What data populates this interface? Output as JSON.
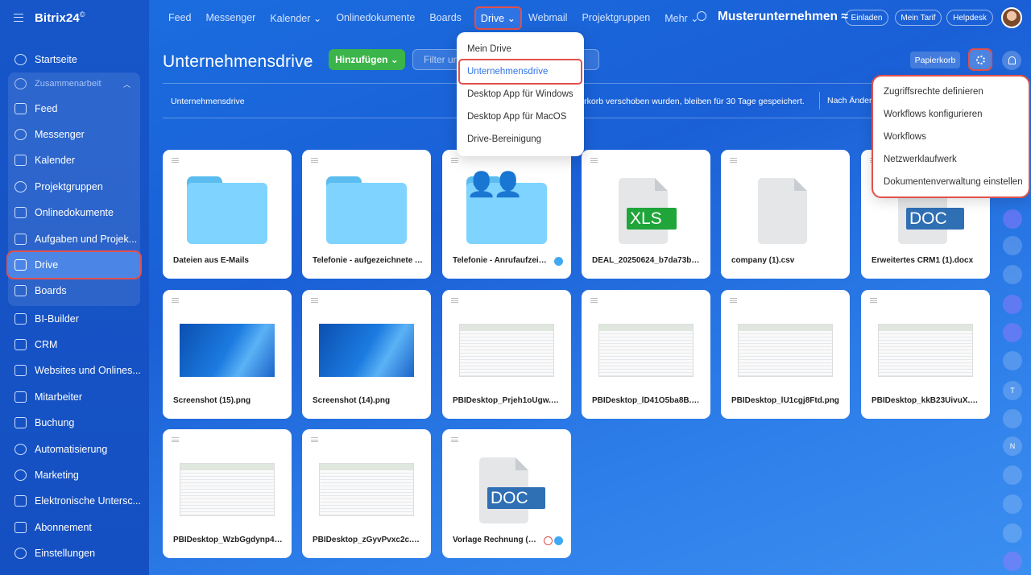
{
  "app": {
    "name": "Bitrix24",
    "mark": "©"
  },
  "sidebar": {
    "items": [
      {
        "label": "Startseite",
        "icon": "home-icon"
      },
      {
        "label": "Zusammenarbeit",
        "icon": "collaboration-icon"
      },
      {
        "label": "Feed",
        "icon": "feed-icon"
      },
      {
        "label": "Messenger",
        "icon": "messenger-icon"
      },
      {
        "label": "Kalender",
        "icon": "calendar-icon"
      },
      {
        "label": "Projektgruppen",
        "icon": "groups-icon"
      },
      {
        "label": "Onlinedokumente",
        "icon": "documents-icon"
      },
      {
        "label": "Aufgaben und Projek...",
        "icon": "tasks-icon"
      },
      {
        "label": "Drive",
        "icon": "drive-icon"
      },
      {
        "label": "Boards",
        "icon": "boards-icon"
      },
      {
        "label": "BI-Builder",
        "icon": "chart-icon"
      },
      {
        "label": "CRM",
        "icon": "crm-icon"
      },
      {
        "label": "Websites und Onlines...",
        "icon": "cart-icon"
      },
      {
        "label": "Mitarbeiter",
        "icon": "employees-icon"
      },
      {
        "label": "Buchung",
        "icon": "booking-icon"
      },
      {
        "label": "Automatisierung",
        "icon": "automation-icon"
      },
      {
        "label": "Marketing",
        "icon": "marketing-icon"
      },
      {
        "label": "Elektronische Untersc...",
        "icon": "signature-icon"
      },
      {
        "label": "Abonnement",
        "icon": "subscription-icon"
      },
      {
        "label": "Einstellungen",
        "icon": "gear-icon"
      }
    ]
  },
  "topnav": {
    "items": [
      "Feed",
      "Messenger",
      "Kalender ⌄",
      "Onlinedokumente",
      "Boards",
      "Drive ⌄",
      "Webmail",
      "Projektgruppen",
      "Mehr ⌄"
    ],
    "company": "Musterunternehmen ≈",
    "invite": "Einladen",
    "tariff": "Mein Tarif",
    "helpdesk": "Helpdesk"
  },
  "header": {
    "title": "Unternehmensdrive",
    "pin": "⚲",
    "add_label": "Hinzufügen ⌄",
    "filter_placeholder": "Filter un",
    "trash_label": "Papierkorb"
  },
  "breadcrumb": "Unternehmensdrive",
  "notice": "ierkorb verschoben wurden, bleiben für 30 Tage gespeichert.",
  "sort_label": "Nach Änder",
  "drive_menu": {
    "items": [
      "Mein Drive",
      "Unternehmensdrive",
      "Desktop App für Windows",
      "Desktop App für MacOS",
      "Drive-Bereinigung"
    ]
  },
  "settings_menu": {
    "items": [
      "Zugriffsrechte definieren",
      "Workflows konfigurieren",
      "Workflows",
      "Netzwerklaufwerk",
      "Dokumentenverwaltung einstellen"
    ]
  },
  "files": [
    {
      "name": "Dateien aus E-Mails",
      "type": "folder"
    },
    {
      "name": "Telefonie - aufgezeichnete A...",
      "type": "folder"
    },
    {
      "name": "Telefonie - Anrufaufzeich...",
      "type": "shared-folder"
    },
    {
      "name": "DEAL_20250624_b7da73bc...",
      "type": "xls",
      "badge": "XLS"
    },
    {
      "name": "company (1).csv",
      "type": "blank"
    },
    {
      "name": "Erweitertes CRM1 (1).docx",
      "type": "doc",
      "badge": "DOC"
    },
    {
      "name": "Screenshot (15).png",
      "type": "screenshot-win"
    },
    {
      "name": "Screenshot (14).png",
      "type": "screenshot-win"
    },
    {
      "name": "PBIDesktop_Prjeh1oUgw.png",
      "type": "screenshot-xl"
    },
    {
      "name": "PBIDesktop_lD41O5ba8B.png",
      "type": "screenshot-xl"
    },
    {
      "name": "PBIDesktop_lU1cgj8Ftd.png",
      "type": "screenshot-xl"
    },
    {
      "name": "PBIDesktop_kkB23UivuX.png",
      "type": "screenshot-xl"
    },
    {
      "name": "PBIDesktop_WzbGgdynp4.p...",
      "type": "screenshot-xl"
    },
    {
      "name": "PBIDesktop_zGyvPvxc2c.png",
      "type": "screenshot-xl"
    },
    {
      "name": "Vorlage Rechnung (De...",
      "type": "doc",
      "badge": "DOC"
    }
  ],
  "rail": {
    "letters": [
      "T",
      "N"
    ]
  }
}
